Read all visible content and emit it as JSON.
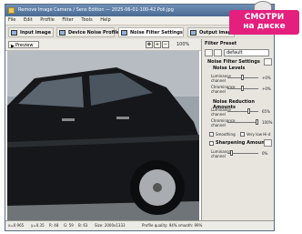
{
  "window": {
    "title": "Remove Image Camera / Sens Edition — 2025-06-01-100-42 Poli.jpg"
  },
  "menu": [
    "File",
    "Edit",
    "Profile",
    "Filter",
    "Tools",
    "Help"
  ],
  "tabs": [
    {
      "label": "Input image"
    },
    {
      "label": "Device Noise Profile"
    },
    {
      "label": "Noise Filter Settings"
    },
    {
      "label": "Output image"
    }
  ],
  "toolbar": {
    "preview_label": "Preview",
    "zoom": "100%"
  },
  "right_panel": {
    "filter_preset_header": "Filter Preset",
    "preset_value": "default",
    "noise_filter_settings": "Noise Filter Settings",
    "noise_levels": "Noise Levels",
    "luminance_channel": "Luminance channel",
    "luminance_value": "+0%",
    "chrominance_channel": "Chrominance channel",
    "chrominance_value": "+0%",
    "noise_reduction_amounts": "Noise Reduction Amounts",
    "nr_luminance_value": "65%",
    "nr_chrominance_value": "100%",
    "smooth_label": "Smoothing",
    "very_low_label": "Very low Hi-d",
    "sharpening_amount": "Sharpening Amount",
    "sharpen_luminance_value": "0%"
  },
  "status": [
    "x=0.965",
    "y=0.35",
    "R: 48",
    "G: 59",
    "B: 63",
    "Size: 2000x1333",
    "Profile quality: 94% smooth: 99%"
  ],
  "badge": {
    "line1": "СМОТРИ",
    "line2": "на диске"
  }
}
